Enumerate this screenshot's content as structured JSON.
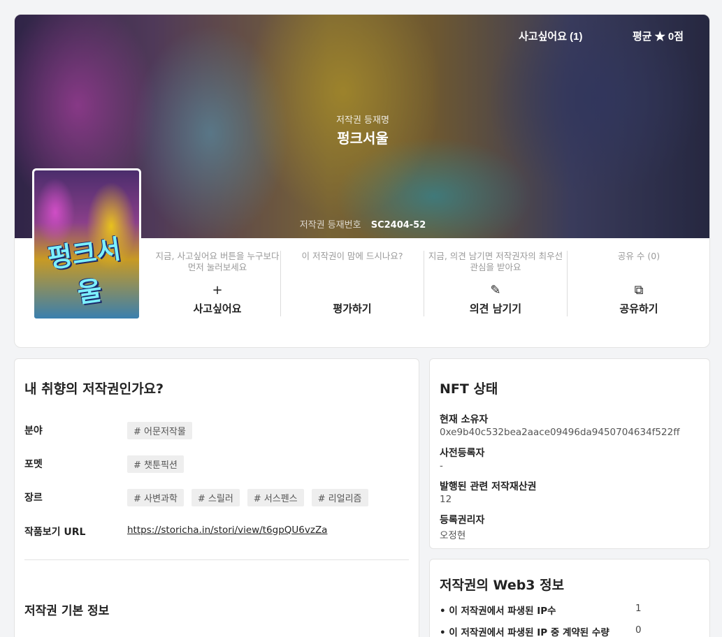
{
  "banner": {
    "wish_count_label": "사고싶어요 (1)",
    "avg_rating_label": "평균 ★ 0점",
    "title_label": "저작권 등재명",
    "title": "펑크서울",
    "reg_label": "저작권 등재번호",
    "reg_number": "SC2404-52"
  },
  "cover": {
    "title_art": "펑크서울"
  },
  "actions": [
    {
      "hint": "지금, 사고싶어요 버튼을 누구보다 먼저 눌러보세요",
      "icon": "+",
      "label": "사고싶어요"
    },
    {
      "hint": "이 저작권이 맘에 드시나요?",
      "icon": "",
      "label": "평가하기"
    },
    {
      "hint": "지금, 의견 남기면 저작권자의 최우선 관심을 받아요",
      "icon": "✎",
      "label": "의견 남기기"
    },
    {
      "hint": "공유 수 (0)",
      "icon": "⧉",
      "label": "공유하기"
    }
  ],
  "taste": {
    "title": "내 취향의 저작권인가요?",
    "rows": [
      {
        "label": "분야",
        "tags": [
          "# 어문저작물"
        ]
      },
      {
        "label": "포멧",
        "tags": [
          "# 챗툰픽션"
        ]
      },
      {
        "label": "장르",
        "tags": [
          "# 사변과학",
          "# 스릴러",
          "# 서스펜스",
          "# 리얼리즘"
        ]
      }
    ],
    "url_label": "작품보기 URL",
    "url": "https://storicha.in/stori/view/t6gpQU6vzZa",
    "basic_title": "저작권 기본 정보"
  },
  "nft": {
    "title": "NFT 상태",
    "items": [
      {
        "label": "현재 소유자",
        "value": "0xe9b40c532bea2aace09496da9450704634f522ff"
      },
      {
        "label": "사전등록자",
        "value": "-"
      },
      {
        "label": "발행된 관련 저작재산권",
        "value": "12"
      },
      {
        "label": "등록권리자",
        "value": "오정현"
      }
    ]
  },
  "web3": {
    "title": "저작권의 Web3 정보",
    "rows": [
      {
        "label": "• 이 저작권에서 파생된 IP수",
        "value": "1"
      },
      {
        "label": "• 이 저작권에서 파생된 IP 중 계약된 수량",
        "value": "0"
      }
    ]
  }
}
